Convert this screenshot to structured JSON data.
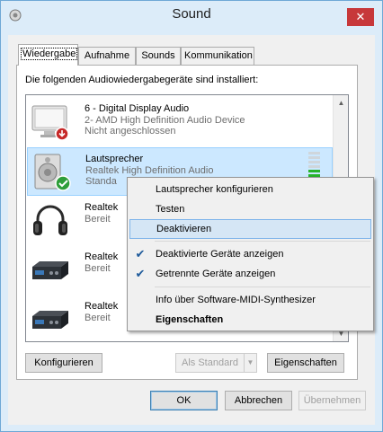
{
  "window": {
    "title": "Sound",
    "close_glyph": "✕",
    "icon": "speaker-settings-icon"
  },
  "tabs": [
    {
      "label": "Wiedergabe",
      "active": true
    },
    {
      "label": "Aufnahme",
      "active": false
    },
    {
      "label": "Sounds",
      "active": false
    },
    {
      "label": "Kommunikation",
      "active": false
    }
  ],
  "panel": {
    "intro": "Die folgenden Audiowiedergabegeräte sind installiert:",
    "devices": [
      {
        "name": "6 - Digital Display Audio",
        "sub": "2- AMD High Definition Audio Device",
        "status": "Nicht angeschlossen",
        "icon": "display-icon",
        "badge": "disconnected-icon"
      },
      {
        "name": "Lautsprecher",
        "sub": "Realtek High Definition Audio",
        "status": "Standa",
        "icon": "speaker-icon",
        "badge": "default-check-icon",
        "selected": true,
        "level": 0.5
      },
      {
        "name": "Realtek",
        "sub": "",
        "status": "Bereit",
        "icon": "headphones-icon"
      },
      {
        "name": "Realtek",
        "sub": "",
        "status": "Bereit",
        "icon": "digital-output-icon"
      },
      {
        "name": "Realtek",
        "sub": "",
        "status": "Bereit",
        "icon": "digital-output-icon"
      }
    ],
    "buttons": {
      "configure": "Konfigurieren",
      "set_default": "Als Standard",
      "properties": "Eigenschaften"
    }
  },
  "dialog_buttons": {
    "ok": "OK",
    "cancel": "Abbrechen",
    "apply": "Übernehmen"
  },
  "context_menu": {
    "items": [
      {
        "label": "Lautsprecher konfigurieren"
      },
      {
        "label": "Testen"
      },
      {
        "label": "Deaktivieren",
        "highlighted": true
      },
      {
        "label": "Deaktivierte Geräte anzeigen",
        "checked": true
      },
      {
        "label": "Getrennte Geräte anzeigen",
        "checked": true
      },
      {
        "label": "Info über Software-MIDI-Synthesizer"
      },
      {
        "label": "Eigenschaften",
        "bold": true
      }
    ]
  },
  "colors": {
    "accent": "#3c7fb1",
    "selection": "#cce8ff",
    "close": "#c7383a",
    "level_on": "#27b32a"
  }
}
